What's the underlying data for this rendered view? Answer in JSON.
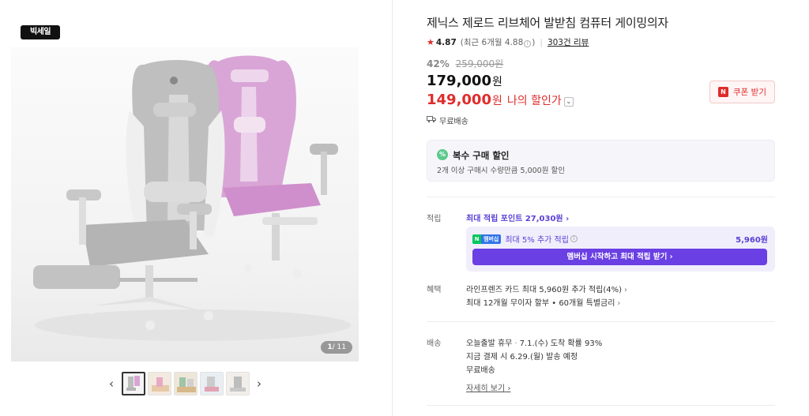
{
  "gallery": {
    "brand_badge": "빅세일",
    "page_current": "1",
    "page_total": "/ 11",
    "prev_icon": "chevron-left-icon",
    "next_icon": "chevron-right-icon"
  },
  "product": {
    "title": "제닉스 제로드 리브체어 발받침 컴퓨터 게이밍의자",
    "rating": "4.87",
    "rating_recent": "(최근 6개월 4.88",
    "rating_recent_end": ")",
    "review_link": "303건 리뷰",
    "discount_pct": "42%",
    "original_price": "259,000원",
    "price": "179,000",
    "price_unit": "원",
    "my_price": "149,000",
    "my_price_unit": "원",
    "my_price_label": "나의 할인가",
    "coupon_label": "쿠폰 받기",
    "coupon_badge": "N",
    "shipping_free": "무료배송"
  },
  "multi_discount": {
    "badge": "%",
    "title": "복수 구매 할인",
    "desc": "2개 이상 구매시 수량만큼 5,000원 할인"
  },
  "points": {
    "label": "적립",
    "max_points_link": "최대 적립 포인트 27,030원",
    "member_badge_n": "N",
    "member_badge_text": "멤버십",
    "member_text": "최대 5% 추가 적립",
    "member_amount": "5,960원",
    "member_button": "멤버십 시작하고 최대 적립 받기"
  },
  "benefits": {
    "label": "혜택",
    "line1": "라인프렌즈 카드 최대 5,960원 추가 적립(4%)",
    "line2": "최대 12개월 무이자 할부 • 60개월 특별금리"
  },
  "delivery": {
    "label": "배송",
    "line1_strong": "오늘출발 휴무",
    "line1_rest": "7.1.(수) 도착 확률 93%",
    "line2": "지금 결제 시 6.29.(월) 발송 예정",
    "line3": "무료배송",
    "detail_link": "자세히 보기"
  },
  "colors": {
    "accent_red": "#e02b2b",
    "membership_purple": "#6a3fe3"
  }
}
